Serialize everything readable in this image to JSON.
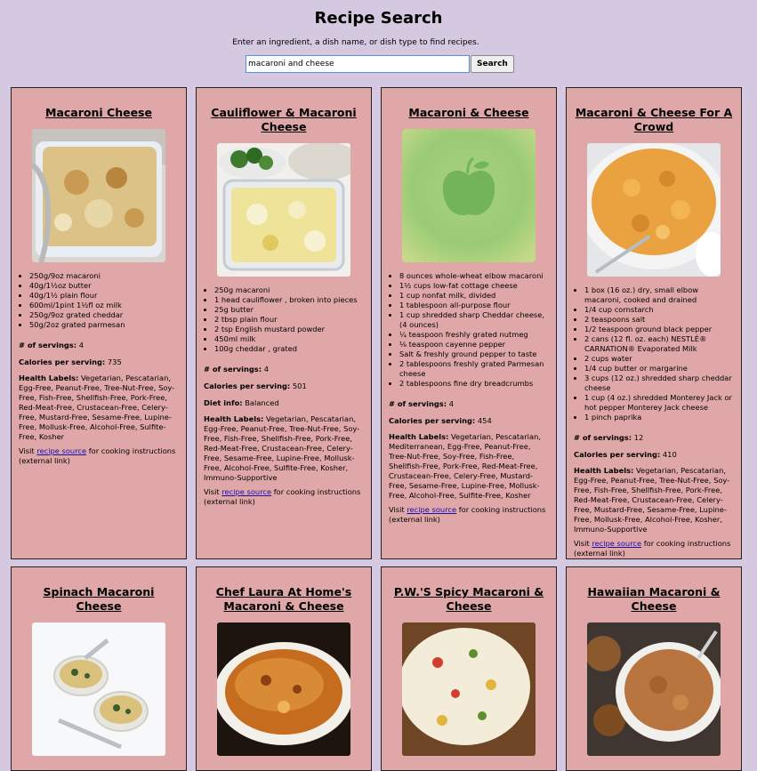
{
  "page": {
    "title": "Recipe Search",
    "intro": "Enter an ingredient, a dish name, or dish type to find recipes."
  },
  "search": {
    "value": "macaroni and cheese",
    "button_label": "Search"
  },
  "labels": {
    "servings": "# of servings:",
    "calories": "Calories per serving:",
    "diet": "Diet info:",
    "health": "Health Labels:",
    "visit_prefix": "Visit",
    "link": "recipe source",
    "visit_suffix": "for cooking instructions (external link)"
  },
  "recipes": [
    {
      "title": "Macaroni Cheese",
      "ingredients": [
        "250g/9oz macaroni",
        "40g/1½oz butter",
        "40g/1½ plain flour",
        "600ml/1pint 1½fl oz milk",
        "250g/9oz grated cheddar",
        "50g/2oz grated parmesan"
      ],
      "servings": "4",
      "calories": "735",
      "health": "Vegetarian, Pescatarian, Egg-Free, Peanut-Free, Tree-Nut-Free, Soy-Free, Fish-Free, Shellfish-Free, Pork-Free, Red-Meat-Free, Crustacean-Free, Celery-Free, Mustard-Free, Sesame-Free, Lupine-Free, Mollusk-Free, Alcohol-Free, Sulfite-Free, Kosher"
    },
    {
      "title": "Cauliflower & Macaroni Cheese",
      "ingredients": [
        "250g macaroni",
        "1 head cauliflower , broken into pieces",
        "25g butter",
        "2 tbsp plain flour",
        "2 tsp English mustard powder",
        "450ml milk",
        "100g cheddar , grated"
      ],
      "servings": "4",
      "calories": "501",
      "diet": "Balanced",
      "health": "Vegetarian, Pescatarian, Egg-Free, Peanut-Free, Tree-Nut-Free, Soy-Free, Fish-Free, Shellfish-Free, Pork-Free, Red-Meat-Free, Crustacean-Free, Celery-Free, Sesame-Free, Lupine-Free, Mollusk-Free, Alcohol-Free, Sulfite-Free, Kosher, Immuno-Supportive"
    },
    {
      "title": "Macaroni & Cheese",
      "ingredients": [
        "8 ounces whole-wheat elbow macaroni",
        "1½ cups low-fat cottage cheese",
        "1 cup nonfat milk, divided",
        "1 tablespoon all-purpose flour",
        "1 cup shredded sharp Cheddar cheese, (4 ounces)",
        "¼ teaspoon freshly grated nutmeg",
        "⅛ teaspoon cayenne pepper",
        "Salt & freshly ground pepper to taste",
        "2 tablespoons freshly grated Parmesan cheese",
        "2 tablespoons fine dry breadcrumbs"
      ],
      "servings": "4",
      "calories": "454",
      "health": "Vegetarian, Pescatarian, Mediterranean, Egg-Free, Peanut-Free, Tree-Nut-Free, Soy-Free, Fish-Free, Shellfish-Free, Pork-Free, Red-Meat-Free, Crustacean-Free, Celery-Free, Mustard-Free, Sesame-Free, Lupine-Free, Mollusk-Free, Alcohol-Free, Sulfite-Free, Kosher"
    },
    {
      "title": "Macaroni & Cheese For A Crowd",
      "ingredients": [
        "1 box (16 oz.) dry, small elbow macaroni, cooked and drained",
        "1/4 cup cornstarch",
        "2 teaspoons salt",
        "1/2 teaspoon ground black pepper",
        "2 cans (12 fl. oz. each) NESTLÉ® CARNATION® Evaporated Milk",
        "2 cups water",
        "1/4 cup butter or margarine",
        "3 cups (12 oz.) shredded sharp cheddar cheese",
        "1 cup (4 oz.) shredded Monterey Jack or hot pepper Monterey Jack cheese",
        "1 pinch paprika"
      ],
      "servings": "12",
      "calories": "410",
      "health": "Vegetarian, Pescatarian, Egg-Free, Peanut-Free, Tree-Nut-Free, Soy-Free, Fish-Free, Shellfish-Free, Pork-Free, Red-Meat-Free, Crustacean-Free, Celery-Free, Mustard-Free, Sesame-Free, Lupine-Free, Mollusk-Free, Alcohol-Free, Kosher, Immuno-Supportive"
    },
    {
      "title": "Spinach Macaroni Cheese"
    },
    {
      "title": "Chef Laura At Home's Macaroni & Cheese"
    },
    {
      "title": "P.W.'S Spicy Macaroni & Cheese"
    },
    {
      "title": "Hawaiian Macaroni & Cheese"
    }
  ]
}
